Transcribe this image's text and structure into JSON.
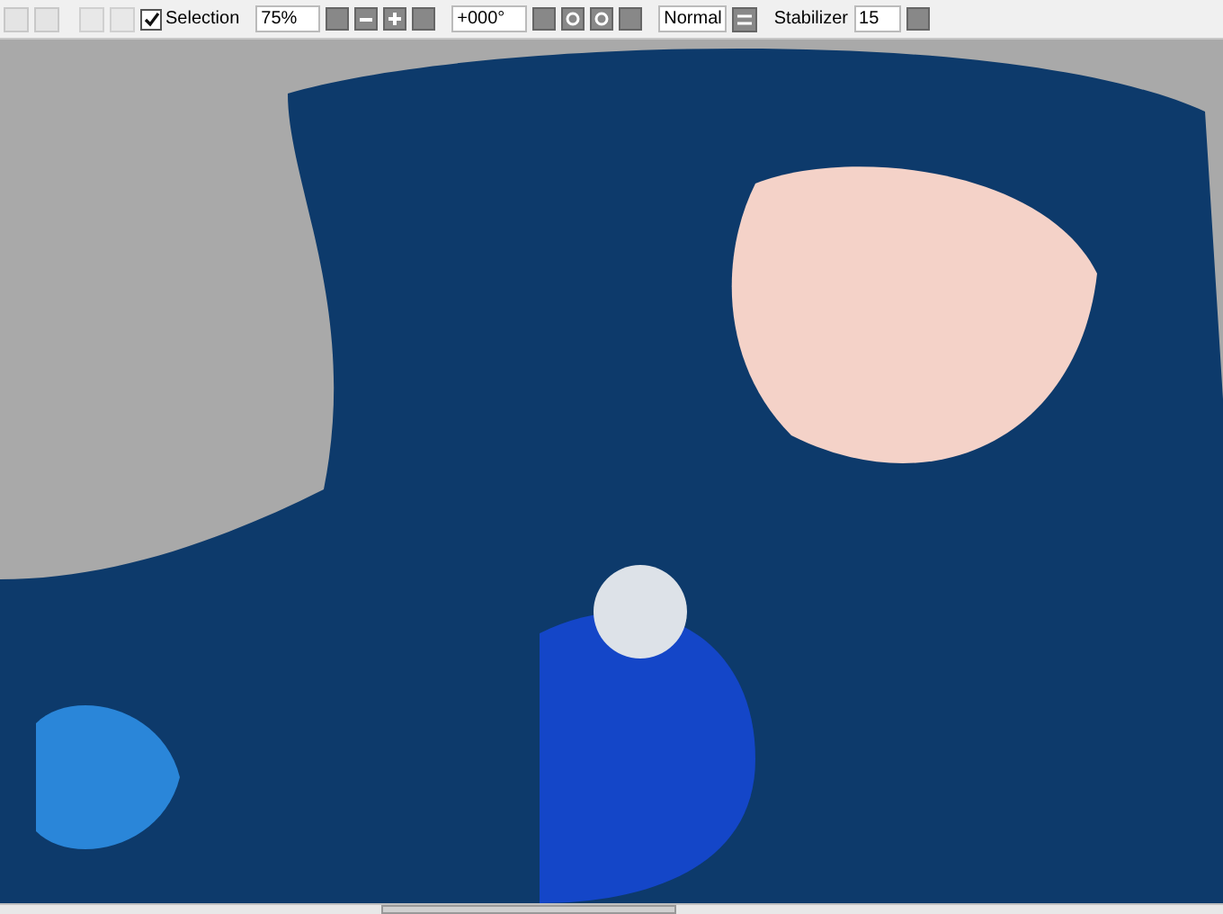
{
  "toolbar": {
    "selection": {
      "label": "Selection",
      "checked": true
    },
    "zoom": "75%",
    "rotation": "+000°",
    "blend_mode": "Normal",
    "stabilizer": {
      "label": "Stabilizer",
      "value": "15"
    }
  }
}
